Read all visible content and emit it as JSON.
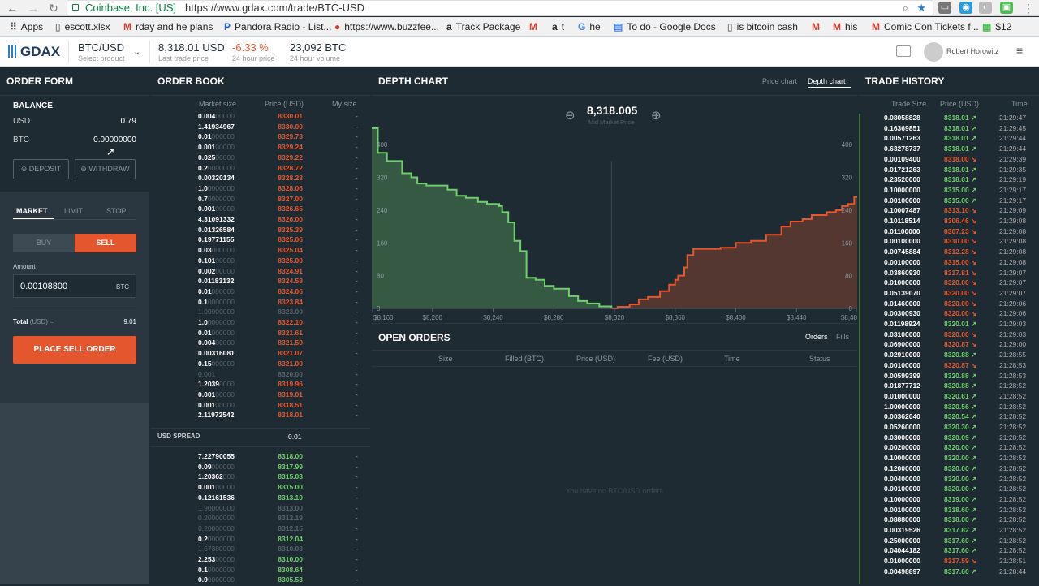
{
  "browser": {
    "secure_label": "Coinbase, Inc. [US]",
    "url": "https://www.gdax.com/trade/BTC-USD",
    "bookmarks": [
      "Apps",
      "escott.xlsx",
      "rday and he plans",
      "Pandora Radio - List...",
      "https://www.buzzfee...",
      "Track Package",
      "t",
      "he",
      "To do - Google Docs",
      "is bitcoin cash",
      "his",
      "Comic Con Tickets f...",
      "$12"
    ]
  },
  "header": {
    "logo": "GDAX",
    "product": "BTC/USD",
    "product_sub": "Select product",
    "last_price": "8,318.01 USD",
    "last_price_sub": "Last trade price",
    "change": "-6.33 %",
    "change_sub": "24 hour price",
    "volume": "23,092 BTC",
    "volume_sub": "24 hour volume",
    "user": "Robert Horowitz"
  },
  "order_form": {
    "title": "ORDER FORM",
    "balance_title": "BALANCE",
    "usd_label": "USD",
    "usd_value": "0.79",
    "btc_label": "BTC",
    "btc_value": "0.00000000",
    "deposit": "DEPOSIT",
    "withdraw": "WITHDRAW",
    "tabs": [
      "MARKET",
      "LIMIT",
      "STOP"
    ],
    "buy": "BUY",
    "sell": "SELL",
    "amount_label": "Amount",
    "amount_value": "0.00108800",
    "amount_unit": "BTC",
    "total_label": "Total",
    "total_unit": "(USD) ≈",
    "total_value": "9.01",
    "place": "PLACE SELL ORDER"
  },
  "order_book": {
    "title": "ORDER BOOK",
    "col_size": "Market size",
    "col_price": "Price (USD)",
    "col_my": "My size",
    "asks": [
      [
        "0.004",
        "00000",
        "8330.01",
        "-"
      ],
      [
        "1.41934967",
        "",
        "8330.00",
        "-"
      ],
      [
        "0.01",
        "000000",
        "8329.73",
        "-"
      ],
      [
        "0.001",
        "00000",
        "8329.24",
        "-"
      ],
      [
        "0.025",
        "00000",
        "8329.22",
        "-"
      ],
      [
        "0.2",
        "0000000",
        "8328.72",
        "-"
      ],
      [
        "0.00320134",
        "",
        "8328.23",
        "-"
      ],
      [
        "1.0",
        "0000000",
        "8328.06",
        "-"
      ],
      [
        "0.7",
        "0000000",
        "8327.00",
        "-"
      ],
      [
        "0.001",
        "00000",
        "8326.65",
        "-"
      ],
      [
        "4.31091332",
        "",
        "8326.00",
        "-"
      ],
      [
        "0.01326584",
        "",
        "8325.39",
        "-"
      ],
      [
        "0.19771155",
        "",
        "8325.06",
        "-"
      ],
      [
        "0.03",
        "000000",
        "8325.04",
        "-"
      ],
      [
        "0.101",
        "00000",
        "8325.00",
        "-"
      ],
      [
        "0.002",
        "00000",
        "8324.91",
        "-"
      ],
      [
        "0.01183132",
        "",
        "8324.58",
        "-"
      ],
      [
        "0.01",
        "000000",
        "8324.06",
        "-"
      ],
      [
        "0.1",
        "0000000",
        "8323.84",
        "-"
      ],
      [
        "",
        "1.00000000",
        "8323.00",
        "-"
      ],
      [
        "1.0",
        "0000000",
        "8322.10",
        "-"
      ],
      [
        "0.01",
        "000000",
        "8321.61",
        "-"
      ],
      [
        "0.004",
        "00000",
        "8321.59",
        "-"
      ],
      [
        "0.00316081",
        "",
        "8321.07",
        "-"
      ],
      [
        "0.15",
        "000000",
        "8321.00",
        "-"
      ],
      [
        "",
        "0.001",
        "8320.00",
        "-"
      ],
      [
        "1.2039",
        "0000",
        "8319.96",
        "-"
      ],
      [
        "0.001",
        "00000",
        "8319.01",
        "-"
      ],
      [
        "0.001",
        "00000",
        "8318.51",
        "-"
      ],
      [
        "2.11972542",
        "",
        "8318.01",
        "-"
      ]
    ],
    "spread_label": "USD SPREAD",
    "spread_value": "0.01",
    "bids": [
      [
        "7.22790055",
        "",
        "8318.00",
        "-"
      ],
      [
        "0.09",
        "000000",
        "8317.99",
        "-"
      ],
      [
        "1.20362",
        "000",
        "8315.03",
        "-"
      ],
      [
        "0.001",
        "00000",
        "8315.00",
        "-"
      ],
      [
        "0.12161536",
        "",
        "8313.10",
        "-"
      ],
      [
        "",
        "1.90000000",
        "8313.00",
        "-"
      ],
      [
        "",
        "0.20000000",
        "8312.19",
        "-"
      ],
      [
        "",
        "0.20000000",
        "8312.15",
        "-"
      ],
      [
        "0.2",
        "0000000",
        "8312.04",
        "-"
      ],
      [
        "",
        "1.67380000",
        "8310.03",
        "-"
      ],
      [
        "2.253",
        "00000",
        "8310.00",
        "-"
      ],
      [
        "0.1",
        "0000000",
        "8308.64",
        "-"
      ],
      [
        "0.9",
        "0000000",
        "8305.53",
        "-"
      ]
    ]
  },
  "depth_chart": {
    "title": "DEPTH CHART",
    "tab_price": "Price chart",
    "tab_depth": "Depth chart",
    "mid_price": "8,318.005",
    "mid_label": "Mid Market Price",
    "zoom_out": "⊖",
    "zoom_in": "⊕"
  },
  "chart_data": {
    "type": "area",
    "x_ticks": [
      "$8,160",
      "$8,200",
      "$8,240",
      "$8,280",
      "$8,320",
      "$8,360",
      "$8,400",
      "$8,440",
      "$8,48"
    ],
    "y_ticks": [
      "400",
      "320",
      "240",
      "160",
      "80",
      "0"
    ],
    "xlim": [
      8160,
      8480
    ],
    "ylim": [
      0,
      440
    ],
    "series": [
      {
        "side": "bid",
        "color": "#6fd06b",
        "x": [
          8160,
          8164,
          8170,
          8180,
          8186,
          8190,
          8196,
          8204,
          8210,
          8216,
          8222,
          8230,
          8236,
          8244,
          8246,
          8250,
          8254,
          8258,
          8262,
          8268,
          8274,
          8280,
          8290,
          8296,
          8302,
          8310,
          8318
        ],
        "y": [
          440,
          380,
          360,
          330,
          320,
          305,
          300,
          300,
          290,
          275,
          270,
          260,
          255,
          250,
          235,
          210,
          165,
          140,
          75,
          70,
          55,
          48,
          30,
          18,
          12,
          5,
          0
        ]
      },
      {
        "side": "ask",
        "color": "#e4572e",
        "x": [
          8318,
          8322,
          8330,
          8336,
          8342,
          8350,
          8356,
          8360,
          8362,
          8366,
          8368,
          8372,
          8380,
          8390,
          8400,
          8410,
          8420,
          8430,
          8436,
          8444,
          8450,
          8460,
          8466,
          8470,
          8474,
          8478,
          8480
        ],
        "y": [
          0,
          4,
          10,
          22,
          28,
          42,
          58,
          70,
          80,
          100,
          130,
          145,
          145,
          148,
          160,
          165,
          180,
          200,
          212,
          218,
          228,
          235,
          240,
          250,
          255,
          272,
          270
        ]
      }
    ],
    "grid": false
  },
  "open_orders": {
    "title": "OPEN ORDERS",
    "tab_orders": "Orders",
    "tab_fills": "Fills",
    "cols": [
      "Size",
      "Filled (BTC)",
      "Price (USD)",
      "Fee (USD)",
      "Time",
      "Status"
    ],
    "empty": "You have no BTC/USD orders"
  },
  "trade_history": {
    "title": "TRADE HISTORY",
    "col_size": "Trade Size",
    "col_price": "Price (USD)",
    "col_time": "Time",
    "rows": [
      [
        "0.08058828",
        "8318.01",
        "21:29:47",
        "up"
      ],
      [
        "0.16369851",
        "8318.01",
        "21:29:45",
        "up"
      ],
      [
        "0.00571263",
        "8318.01",
        "21:29:44",
        "up"
      ],
      [
        "0.63278737",
        "8318.01",
        "21:29:44",
        "up"
      ],
      [
        "0.00109400",
        "8318.00",
        "21:29:39",
        "down"
      ],
      [
        "0.01721263",
        "8318.01",
        "21:29:35",
        "up"
      ],
      [
        "0.23520000",
        "8318.01",
        "21:29:19",
        "up"
      ],
      [
        "0.10000000",
        "8315.00",
        "21:29:17",
        "up"
      ],
      [
        "0.00100000",
        "8315.00",
        "21:29:17",
        "up"
      ],
      [
        "0.10007487",
        "8313.10",
        "21:29:09",
        "down"
      ],
      [
        "0.10118514",
        "8306.46",
        "21:29:08",
        "down"
      ],
      [
        "0.01100000",
        "8307.23",
        "21:29:08",
        "down"
      ],
      [
        "0.00100000",
        "8310.00",
        "21:29:08",
        "down"
      ],
      [
        "0.00745884",
        "8312.28",
        "21:29:08",
        "down"
      ],
      [
        "0.00100000",
        "8315.00",
        "21:29:08",
        "down"
      ],
      [
        "0.03860930",
        "8317.81",
        "21:29:07",
        "down"
      ],
      [
        "0.01000000",
        "8320.00",
        "21:29:07",
        "down"
      ],
      [
        "0.05139070",
        "8320.00",
        "21:29:07",
        "down"
      ],
      [
        "0.01460000",
        "8320.00",
        "21:29:06",
        "down"
      ],
      [
        "0.00300930",
        "8320.00",
        "21:29:06",
        "down"
      ],
      [
        "0.01198924",
        "8320.01",
        "21:29:03",
        "up"
      ],
      [
        "0.03100000",
        "8320.00",
        "21:29:03",
        "down"
      ],
      [
        "0.06900000",
        "8320.87",
        "21:29:00",
        "down"
      ],
      [
        "0.02910000",
        "8320.88",
        "21:28:55",
        "up"
      ],
      [
        "0.00100000",
        "8320.87",
        "21:28:53",
        "down"
      ],
      [
        "0.00599399",
        "8320.88",
        "21:28:53",
        "up"
      ],
      [
        "0.01877712",
        "8320.88",
        "21:28:52",
        "up"
      ],
      [
        "0.01000000",
        "8320.61",
        "21:28:52",
        "up"
      ],
      [
        "1.00000000",
        "8320.56",
        "21:28:52",
        "up"
      ],
      [
        "0.00362040",
        "8320.54",
        "21:28:52",
        "up"
      ],
      [
        "0.05260000",
        "8320.30",
        "21:28:52",
        "up"
      ],
      [
        "0.03000000",
        "8320.09",
        "21:28:52",
        "up"
      ],
      [
        "0.00200000",
        "8320.00",
        "21:28:52",
        "up"
      ],
      [
        "0.10000000",
        "8320.00",
        "21:28:52",
        "up"
      ],
      [
        "0.12000000",
        "8320.00",
        "21:28:52",
        "up"
      ],
      [
        "0.00400000",
        "8320.00",
        "21:28:52",
        "up"
      ],
      [
        "0.00100000",
        "8320.00",
        "21:28:52",
        "up"
      ],
      [
        "0.10000000",
        "8319.00",
        "21:28:52",
        "up"
      ],
      [
        "0.00100000",
        "8318.60",
        "21:28:52",
        "up"
      ],
      [
        "0.08880000",
        "8318.00",
        "21:28:52",
        "up"
      ],
      [
        "0.00319526",
        "8317.82",
        "21:28:52",
        "up"
      ],
      [
        "0.25000000",
        "8317.60",
        "21:28:52",
        "up"
      ],
      [
        "0.04044182",
        "8317.60",
        "21:28:52",
        "up"
      ],
      [
        "0.01000000",
        "8317.59",
        "21:28:51",
        "down"
      ],
      [
        "0.00498897",
        "8317.60",
        "21:28:44",
        "up"
      ]
    ]
  }
}
